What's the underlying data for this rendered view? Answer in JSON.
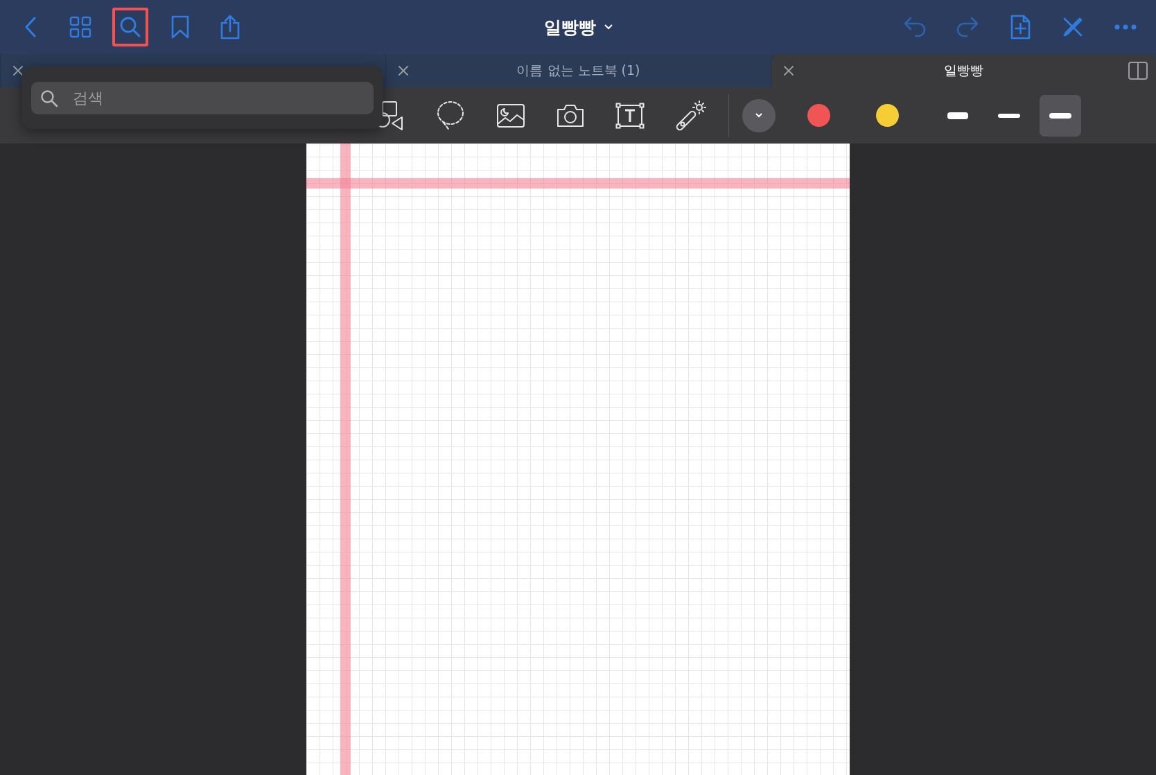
{
  "nav_bar": {
    "left_buttons": [
      {
        "kind": "back",
        "selected": false
      },
      {
        "kind": "grid",
        "selected": false
      },
      {
        "kind": "search",
        "selected": true
      },
      {
        "kind": "bookmark",
        "selected": false
      },
      {
        "kind": "share",
        "selected": false
      }
    ],
    "title": "일빵빵",
    "right_buttons": [
      {
        "kind": "undo"
      },
      {
        "kind": "redo"
      },
      {
        "kind": "add-page"
      },
      {
        "kind": "pen-off"
      },
      {
        "kind": "more"
      }
    ]
  },
  "tabs": [
    {
      "selected": false
    },
    {
      "label": "이름 없는 노트북 (1)",
      "selected": false
    },
    {
      "label": "일빵빵",
      "selected": true
    }
  ],
  "search_popover": {
    "placeholder": "검색"
  },
  "tools": [
    {
      "kind": "shapes"
    },
    {
      "kind": "lasso"
    },
    {
      "kind": "image"
    },
    {
      "kind": "camera"
    },
    {
      "kind": "text"
    },
    {
      "kind": "laser"
    }
  ],
  "colors": [
    {
      "kind": "picker",
      "color": "#5a5a5e"
    },
    {
      "kind": "swatch",
      "color": "#f05454"
    },
    {
      "kind": "swatch",
      "color": "#f5cd35"
    }
  ],
  "stroke_widths": [
    {
      "selected": false,
      "kind": "thick"
    },
    {
      "selected": false,
      "kind": "thin"
    },
    {
      "selected": true,
      "kind": "medium"
    }
  ]
}
